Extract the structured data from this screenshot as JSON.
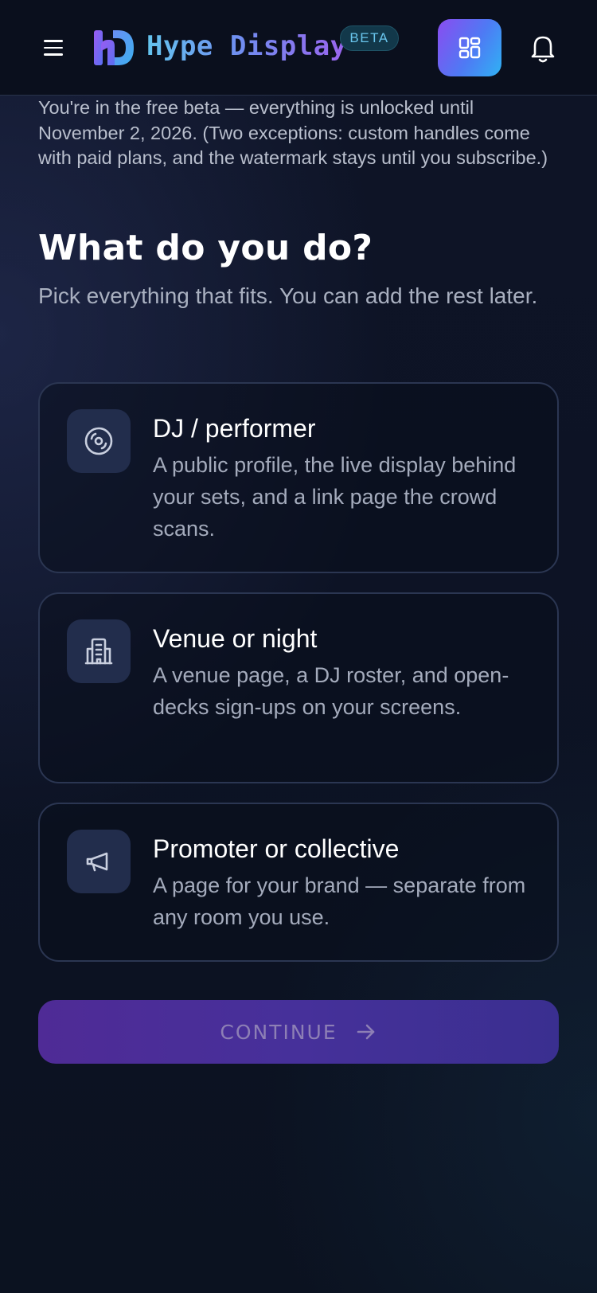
{
  "header": {
    "brand_name": "Hype Display",
    "beta_badge": "BETA",
    "accent_gradient": [
      "#8a4cf0",
      "#4e7af4",
      "#2fb2f4"
    ],
    "icons": [
      "menu-icon",
      "logo-mark",
      "grid-icon",
      "bell-icon"
    ]
  },
  "intro": {
    "text": "You're in the free beta — everything is unlocked until November 2, 2026. (Two exceptions: custom handles come with paid plans, and the watermark stays until you subscribe.)"
  },
  "main": {
    "title": "What do you do?",
    "subtitle": "Pick everything that fits. You can add the rest later.",
    "options": [
      {
        "icon": "vinyl-disc-icon",
        "title": "DJ / performer",
        "description": "A public profile, the live display behind your sets, and a link page the crowd scans."
      },
      {
        "icon": "building-icon",
        "title": "Venue or night",
        "description": "A venue page, a DJ roster, and open-decks sign-ups on your screens."
      },
      {
        "icon": "megaphone-icon",
        "title": "Promoter or collective",
        "description": "A page for your brand — separate from any room you use."
      }
    ],
    "continue_label": "CONTINUE"
  }
}
